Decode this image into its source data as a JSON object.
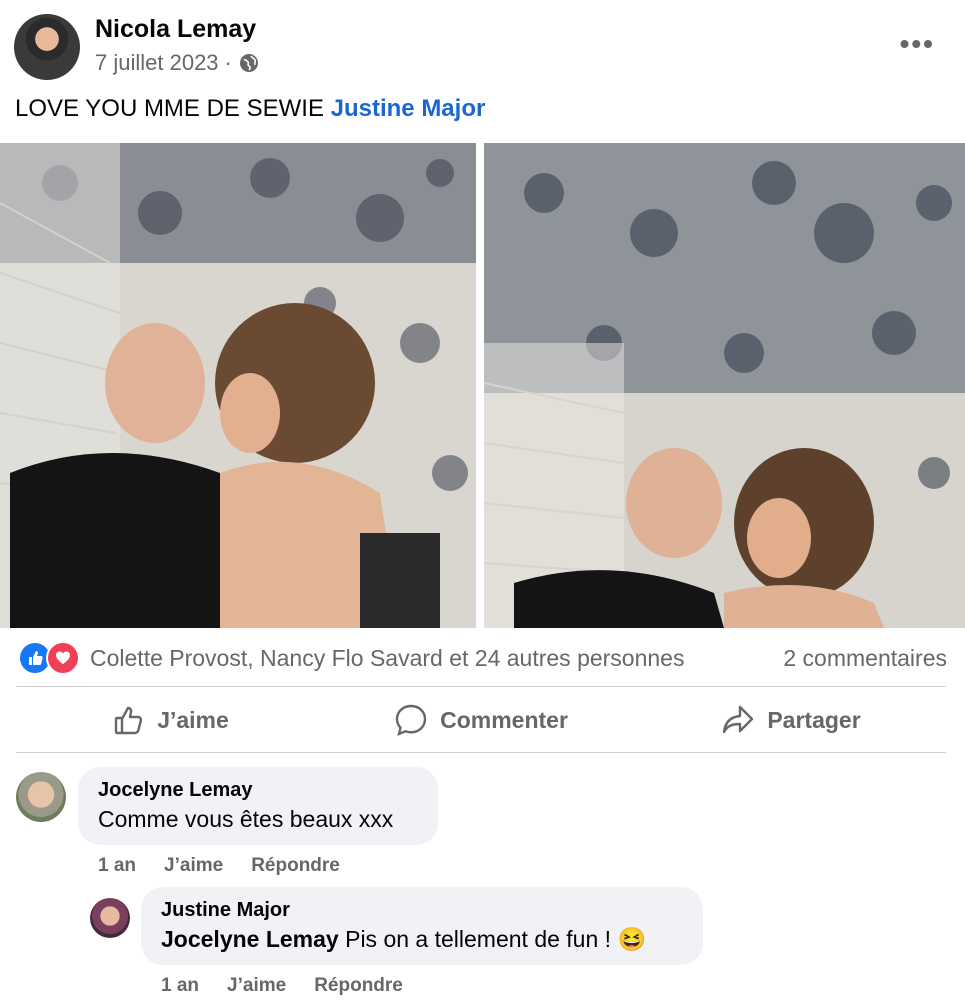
{
  "post": {
    "author": "Nicola Lemay",
    "date": "7 juillet 2023",
    "separator": "·",
    "audience_icon": "globe-icon",
    "more_label": "•••",
    "text": "LOVE YOU MME DE SEWIE",
    "mention": "Justine Major"
  },
  "reactions": {
    "icons": [
      "like-icon",
      "love-icon"
    ],
    "summary": "Colette Provost, Nancy Flo Savard et 24 autres personnes",
    "comments_count": "2 commentaires"
  },
  "actions": {
    "like": "J’aime",
    "comment": "Commenter",
    "share": "Partager"
  },
  "comments": [
    {
      "author": "Jocelyne Lemay",
      "text": "Comme vous êtes beaux xxx",
      "time": "1 an",
      "like": "J’aime",
      "reply": "Répondre"
    },
    {
      "author": "Justine Major",
      "tag": "Jocelyne Lemay",
      "text": "Pis on a tellement de fun !",
      "emoji": "😆",
      "time": "1 an",
      "like": "J’aime",
      "reply": "Répondre"
    }
  ],
  "colors": {
    "accent": "#1b67d2",
    "like_blue": "#1877f2",
    "love_red": "#f33e58",
    "muted": "#65676b",
    "bubble": "#f0f2f5"
  }
}
